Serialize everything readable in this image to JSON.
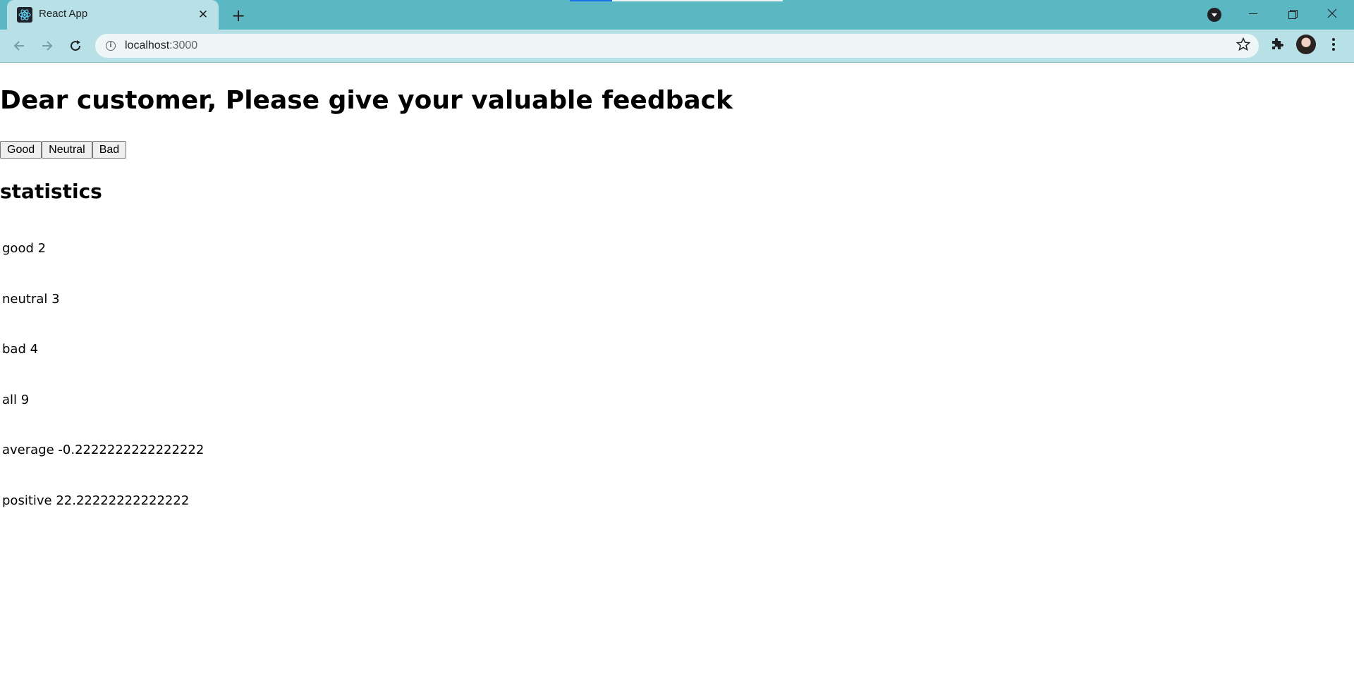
{
  "browser": {
    "tab_title": "React App",
    "tab_close": "✕",
    "new_tab": "+",
    "url_host": "localhost",
    "url_port": ":3000",
    "colors": {
      "chrome": "#5bb8c2",
      "toolbar": "#b7e1e6",
      "omnibox": "#eef6f7"
    }
  },
  "page": {
    "heading": "Dear customer, Please give your valuable feedback",
    "buttons": {
      "good": "Good",
      "neutral": "Neutral",
      "bad": "Bad"
    },
    "statistics_title": "statistics",
    "stats": {
      "good": "good 2",
      "neutral": "neutral 3",
      "bad": "bad 4",
      "all": "all 9",
      "average": "average -0.2222222222222222",
      "positive": "positive 22.22222222222222"
    }
  }
}
